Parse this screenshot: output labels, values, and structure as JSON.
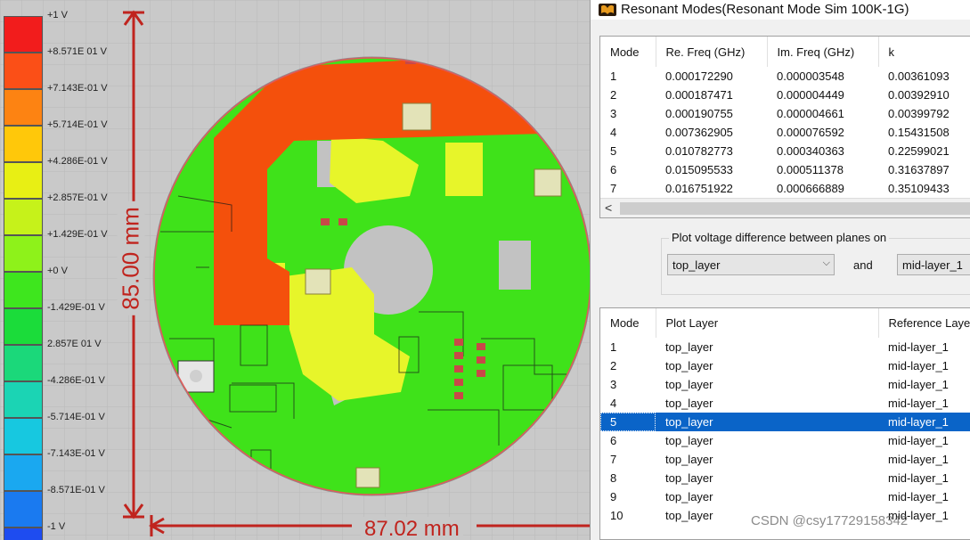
{
  "legend": {
    "labels": [
      "+1 V",
      "+8.571E 01 V",
      "+7.143E-01 V",
      "+5.714E-01 V",
      "+4.286E-01 V",
      "+2.857E-01 V",
      "+1.429E-01 V",
      "+0 V",
      "-1.429E-01 V",
      "2.857E 01 V",
      "-4.286E-01 V",
      "-5.714E-01 V",
      "-7.143E-01 V",
      "-8.571E-01 V",
      "-1 V"
    ],
    "colors": [
      "#f21c1c",
      "#fb4f17",
      "#fd8312",
      "#ffc80a",
      "#e8ef14",
      "#c6f21a",
      "#8ef21a",
      "#3ee61e",
      "#1bdc3a",
      "#1bd87a",
      "#1bd4b4",
      "#17c8e0",
      "#1aa8f0",
      "#1a7af0",
      "#1e4cf0"
    ]
  },
  "dimensions": {
    "vertical": "85.00 mm",
    "horizontal": "87.02 mm"
  },
  "board": {
    "outline_color": "#e05a5a",
    "copper_green": "#3fe21a",
    "plane_orange": "#f4500c",
    "pad_yellow": "#e7f52a",
    "dimension_color": "#c0241e"
  },
  "window": {
    "title": "Resonant Modes(Resonant Mode Sim 100K-1G)",
    "icon": "app-logo-icon"
  },
  "modes_table": {
    "headers": [
      "Mode",
      "Re. Freq (GHz)",
      "Im. Freq (GHz)",
      "k"
    ],
    "rows": [
      [
        "1",
        "0.000172290",
        "0.000003548",
        "0.00361093"
      ],
      [
        "2",
        "0.000187471",
        "0.000004449",
        "0.00392910"
      ],
      [
        "3",
        "0.000190755",
        "0.000004661",
        "0.00399792"
      ],
      [
        "4",
        "0.007362905",
        "0.000076592",
        "0.15431508"
      ],
      [
        "5",
        "0.010782773",
        "0.000340363",
        "0.22599021"
      ],
      [
        "6",
        "0.015095533",
        "0.000511378",
        "0.31637897"
      ],
      [
        "7",
        "0.016751922",
        "0.000666889",
        "0.35109433"
      ]
    ],
    "scroll_left": "<"
  },
  "plot_voltage": {
    "label": "Plot voltage difference between planes on",
    "plane_a": "top_layer",
    "and_label": "and",
    "plane_b": "mid-layer_1",
    "chevron": "⌵"
  },
  "layers_table": {
    "headers": [
      "Mode",
      "Plot Layer",
      "Reference Layer"
    ],
    "rows": [
      [
        "1",
        "top_layer",
        "mid-layer_1"
      ],
      [
        "2",
        "top_layer",
        "mid-layer_1"
      ],
      [
        "3",
        "top_layer",
        "mid-layer_1"
      ],
      [
        "4",
        "top_layer",
        "mid-layer_1"
      ],
      [
        "5",
        "top_layer",
        "mid-layer_1"
      ],
      [
        "6",
        "top_layer",
        "mid-layer_1"
      ],
      [
        "7",
        "top_layer",
        "mid-layer_1"
      ],
      [
        "8",
        "top_layer",
        "mid-layer_1"
      ],
      [
        "9",
        "top_layer",
        "mid-layer_1"
      ],
      [
        "10",
        "top_layer",
        "mid-layer_1"
      ]
    ],
    "selected_mode": "5"
  },
  "watermark": "CSDN @csy17729158342"
}
